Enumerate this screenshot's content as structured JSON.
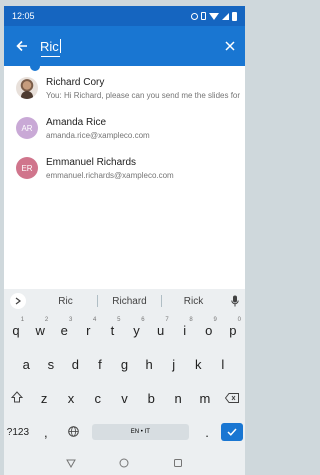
{
  "status_bar": {
    "time": "12:05"
  },
  "search": {
    "query": "Ric"
  },
  "results": [
    {
      "name": "Richard Cory",
      "detail": "You: Hi Richard, please can you send me the slides for",
      "avatar": "photo",
      "initials": "",
      "color": ""
    },
    {
      "name": "Amanda Rice",
      "detail": "amanda.rice@xampleco.com",
      "avatar": "initials",
      "initials": "AR",
      "color": "#c9a9d6"
    },
    {
      "name": "Emmanuel Richards",
      "detail": "emmanuel.richards@xampleco.com",
      "avatar": "initials",
      "initials": "ER",
      "color": "#d0758c"
    }
  ],
  "keyboard": {
    "suggestions": [
      "Ric",
      "Richard",
      "Rick"
    ],
    "row1": [
      {
        "key": "q",
        "hint": "1"
      },
      {
        "key": "w",
        "hint": "2"
      },
      {
        "key": "e",
        "hint": "3"
      },
      {
        "key": "r",
        "hint": "4"
      },
      {
        "key": "t",
        "hint": "5"
      },
      {
        "key": "y",
        "hint": "6"
      },
      {
        "key": "u",
        "hint": "7"
      },
      {
        "key": "i",
        "hint": "8"
      },
      {
        "key": "o",
        "hint": "9"
      },
      {
        "key": "p",
        "hint": "0"
      }
    ],
    "row2": [
      "a",
      "s",
      "d",
      "f",
      "g",
      "h",
      "j",
      "k",
      "l"
    ],
    "row3": [
      "z",
      "x",
      "c",
      "v",
      "b",
      "n",
      "m"
    ],
    "symbols_label": "?123",
    "comma_label": ",",
    "language_label": "EN • IT",
    "period_label": "."
  },
  "colors": {
    "accent": "#1976d2",
    "status": "#1565c0"
  }
}
